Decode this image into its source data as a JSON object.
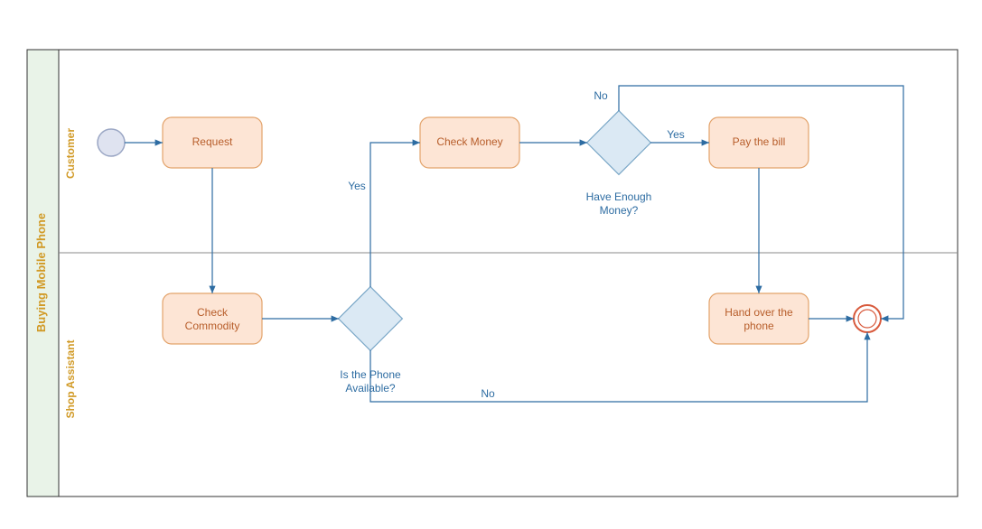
{
  "pool": {
    "title": "Buying Mobile Phone"
  },
  "lanes": {
    "customer": "Customer",
    "assistant": "Shop Assistant"
  },
  "tasks": {
    "request": "Request",
    "check_money": "Check Money",
    "pay_bill": "Pay the bill",
    "check_commodity": "Check Commodity",
    "hand_over": {
      "l1": "Hand over the",
      "l2": "phone"
    }
  },
  "gateways": {
    "phone_available": {
      "l1": "Is the Phone",
      "l2": "Available?"
    },
    "enough_money": {
      "l1": "Have Enough",
      "l2": "Money?"
    }
  },
  "labels": {
    "yes": "Yes",
    "no": "No"
  }
}
